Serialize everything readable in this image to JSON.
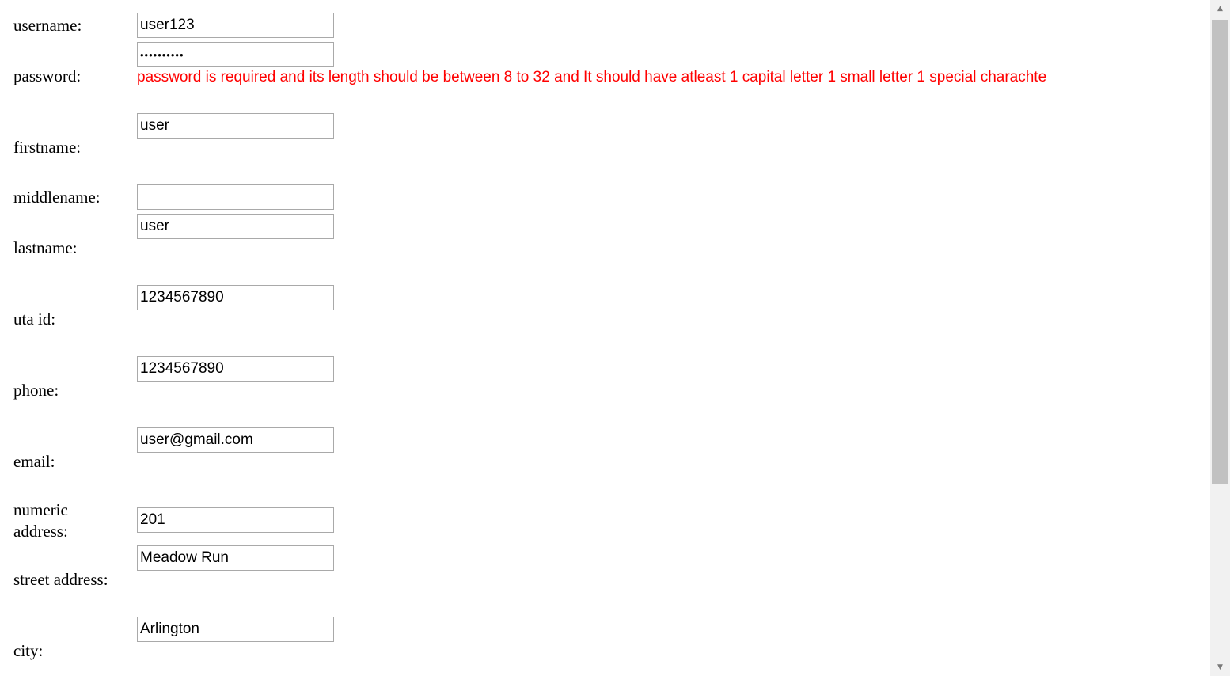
{
  "form": {
    "username": {
      "label": "username:",
      "value": "user123"
    },
    "password": {
      "label": "password:",
      "value": "••••••••••",
      "error": "password is required and its length should be between 8 to 32 and It should have atleast 1 capital letter 1 small letter 1 special charachte"
    },
    "firstname": {
      "label": "firstname:",
      "value": "user"
    },
    "middlename": {
      "label": "middlename:",
      "value": ""
    },
    "lastname": {
      "label": "lastname:",
      "value": "user"
    },
    "uta_id": {
      "label": "uta id:",
      "value": "1234567890"
    },
    "phone": {
      "label": "phone:",
      "value": "1234567890"
    },
    "email": {
      "label": "email:",
      "value": "user@gmail.com"
    },
    "numeric_address": {
      "label_line1": "numeric",
      "label_line2": "address:",
      "value": "201"
    },
    "street_address": {
      "label": "street address:",
      "value": "Meadow Run"
    },
    "city": {
      "label": "city:",
      "value": "Arlington"
    }
  },
  "scrollbar": {
    "up_icon": "triangle-up-icon",
    "down_icon": "triangle-down-icon"
  },
  "colors": {
    "error": "#ff0000",
    "border": "#a9a9a9",
    "scroll_track": "#f1f1f1",
    "scroll_thumb": "#c1c1c1"
  }
}
